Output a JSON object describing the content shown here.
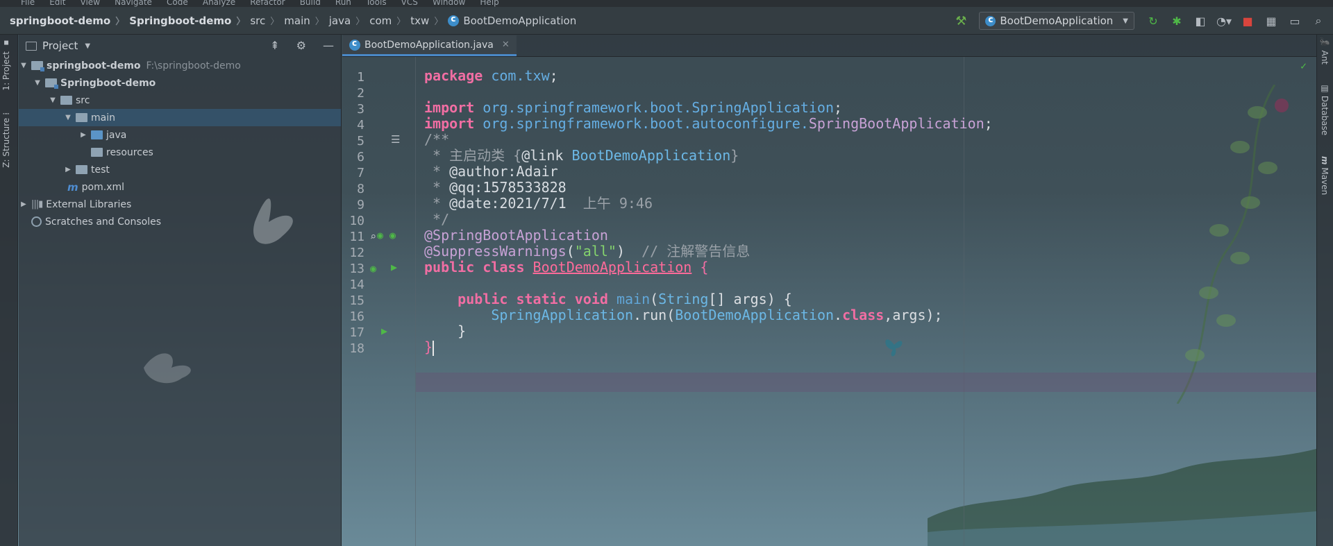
{
  "menubar": {
    "items": [
      "File",
      "Edit",
      "View",
      "Navigate",
      "Code",
      "Analyze",
      "Refactor",
      "Build",
      "Run",
      "Tools",
      "VCS",
      "Window",
      "Help"
    ]
  },
  "breadcrumbs": [
    "springboot-demo",
    "Springboot-demo",
    "src",
    "main",
    "java",
    "com",
    "txw",
    "BootDemoApplication"
  ],
  "run_config": {
    "label": "BootDemoApplication"
  },
  "left_strip": {
    "project_tab": "1: Project",
    "structure_tab": "Z: Structure"
  },
  "right_strip": {
    "ant": "Ant",
    "database": "Database",
    "maven": "Maven"
  },
  "project_panel": {
    "title": "Project",
    "tree": {
      "root": {
        "label": "springboot-demo",
        "path": "F:\\springboot-demo"
      },
      "module": "Springboot-demo",
      "src": "src",
      "main": "main",
      "java": "java",
      "resources": "resources",
      "test": "test",
      "pom": "pom.xml",
      "external": "External Libraries",
      "scratches": "Scratches and Consoles"
    }
  },
  "editor": {
    "tab_label": "BootDemoApplication.java",
    "line_numbers": [
      "1",
      "2",
      "3",
      "4",
      "5",
      "6",
      "7",
      "8",
      "9",
      "10",
      "11",
      "12",
      "13",
      "14",
      "15",
      "16",
      "17",
      "18"
    ],
    "code": {
      "l1_kw": "package",
      "l1_pkg": " com.txw",
      "l1_end": ";",
      "l3_kw": "import",
      "l3_pkg": " org.springframework.boot.SpringApplication",
      "l3_end": ";",
      "l4_kw": "import",
      "l4_pkg": " org.springframework.boot.autoconfigure.",
      "l4_cls": "SpringBootApplication",
      "l4_end": ";",
      "l5": "/**",
      "l6_a": " * 主启动类 {",
      "l6_tag": "@link",
      "l6_cls": " BootDemoApplication",
      "l6_b": "}",
      "l7_a": " * ",
      "l7_tag": "@author:Adair",
      "l8_a": " * ",
      "l8_tag": "@qq:1578533828",
      "l9_a": " * ",
      "l9_tag": "@date:2021/7/1",
      "l9_b": "  上午 9:46",
      "l10": " */",
      "l11": "@SpringBootApplication",
      "l12_an": "@SuppressWarnings",
      "l12_p1": "(",
      "l12_str": "\"all\"",
      "l12_p2": ")",
      "l12_cm": "  // 注解警告信息",
      "l13_kw": "public class ",
      "l13_cls": "BootDemoApplication",
      "l13_end": " {",
      "l15_kw": "    public static void ",
      "l15_mt": "main",
      "l15_a": "(",
      "l15_cls": "String",
      "l15_b": "[] args) {",
      "l16_cls": "        SpringApplication",
      "l16_a": ".run(",
      "l16_cls2": "BootDemoApplication",
      "l16_dot": ".",
      "l16_kw": "class",
      "l16_b": ",args);",
      "l17": "    }",
      "l18": "}"
    }
  }
}
